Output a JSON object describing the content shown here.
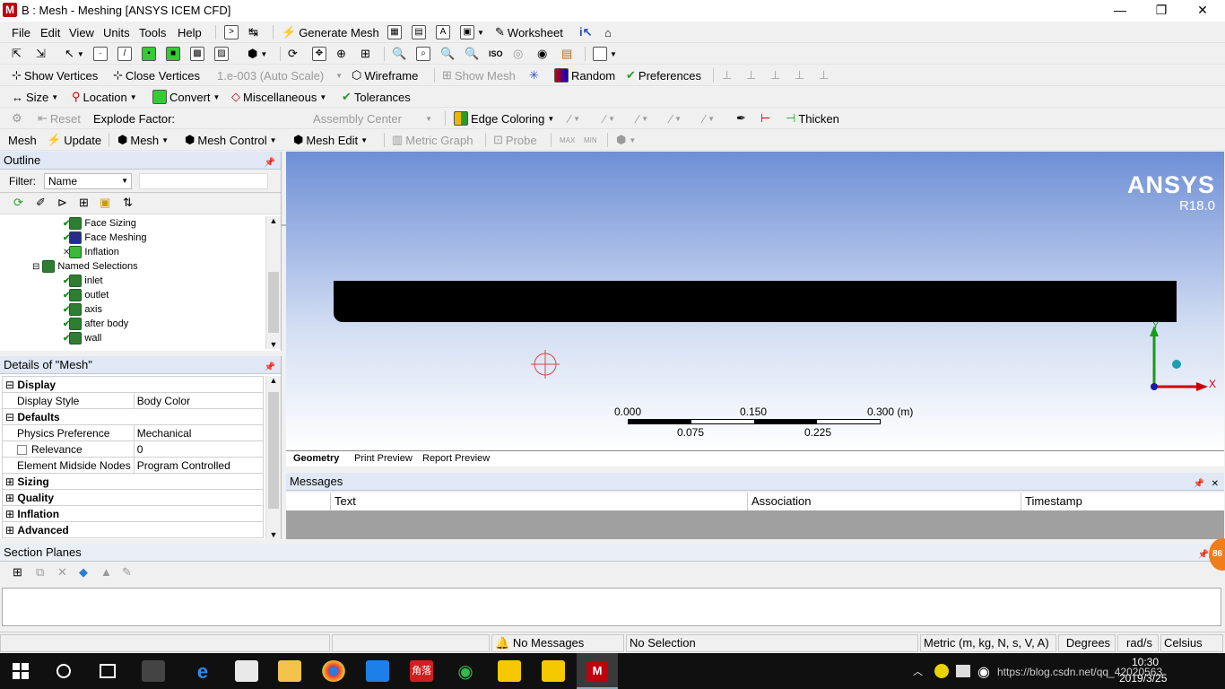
{
  "window": {
    "title": "B : Mesh - Meshing [ANSYS ICEM CFD]",
    "logo": "M",
    "minimize": "—",
    "restore": "❐",
    "close": "✕"
  },
  "menu": [
    "File",
    "Edit",
    "View",
    "Units",
    "Tools",
    "Help"
  ],
  "toolbar1": {
    "generate_mesh": "Generate Mesh",
    "worksheet": "Worksheet"
  },
  "toolbar3": {
    "show_vertices": "Show Vertices",
    "close_vertices": "Close Vertices",
    "auto_scale": "1.e-003 (Auto Scale)",
    "wireframe": "Wireframe",
    "show_mesh": "Show Mesh",
    "random": "Random",
    "preferences": "Preferences"
  },
  "toolbar4": {
    "size": "Size",
    "location": "Location",
    "convert": "Convert",
    "miscellaneous": "Miscellaneous",
    "tolerances": "Tolerances"
  },
  "toolbar5": {
    "reset": "Reset",
    "explode_factor": "Explode Factor:",
    "assembly_center": "Assembly Center",
    "edge_coloring": "Edge Coloring",
    "thicken": "Thicken"
  },
  "toolbar6": {
    "mesh": "Mesh",
    "update": "Update",
    "mesh_menu": "Mesh",
    "mesh_control": "Mesh Control",
    "mesh_edit": "Mesh Edit",
    "metric_graph": "Metric Graph",
    "probe": "Probe"
  },
  "outline": {
    "title": "Outline",
    "filter_label": "Filter:",
    "filter_value": "Name",
    "items": [
      {
        "label": "Face Sizing",
        "state": "check"
      },
      {
        "label": "Face Meshing",
        "state": "check"
      },
      {
        "label": "Inflation",
        "state": "x"
      },
      {
        "label": "Named Selections",
        "state": "none"
      },
      {
        "label": "inlet",
        "state": "check"
      },
      {
        "label": "outlet",
        "state": "check"
      },
      {
        "label": "axis",
        "state": "check"
      },
      {
        "label": "after body",
        "state": "check"
      },
      {
        "label": "wall",
        "state": "check"
      }
    ]
  },
  "details": {
    "title": "Details of \"Mesh\"",
    "rows": [
      {
        "type": "group",
        "expanded": true,
        "label": "Display"
      },
      {
        "type": "prop",
        "label": "Display Style",
        "value": "Body Color"
      },
      {
        "type": "group",
        "expanded": true,
        "label": "Defaults"
      },
      {
        "type": "prop",
        "label": "Physics Preference",
        "value": "Mechanical"
      },
      {
        "type": "prop",
        "label": "Relevance",
        "value": "0",
        "checkbox": true
      },
      {
        "type": "prop",
        "label": "Element Midside Nodes",
        "value": "Program Controlled"
      },
      {
        "type": "group",
        "expanded": false,
        "label": "Sizing"
      },
      {
        "type": "group",
        "expanded": false,
        "label": "Quality"
      },
      {
        "type": "group",
        "expanded": false,
        "label": "Inflation"
      },
      {
        "type": "group",
        "expanded": false,
        "label": "Advanced"
      }
    ]
  },
  "viewport": {
    "brand": "ANSYS",
    "version": "R18.0",
    "scale_top": [
      "0.000",
      "0.150",
      "0.300 (m)"
    ],
    "scale_bottom": [
      "0.075",
      "0.225"
    ],
    "axis_x": "X",
    "axis_y": "Y"
  },
  "view_tabs": [
    "Geometry",
    "Print Preview",
    "Report Preview"
  ],
  "messages": {
    "title": "Messages",
    "columns": [
      "Text",
      "Association",
      "Timestamp"
    ]
  },
  "section_planes": {
    "title": "Section Planes"
  },
  "status": {
    "messages": "No Messages",
    "selection": "No Selection",
    "units": "Metric (m, kg, N, s, V, A)",
    "angle": "Degrees",
    "angular_velocity": "rad/s",
    "temperature": "Celsius"
  },
  "badge": "86",
  "clock": {
    "time": "10:30",
    "date": "2019/3/25"
  },
  "watermark": "https://blog.csdn.net/qq_42020563",
  "taskbar_app": "角落"
}
